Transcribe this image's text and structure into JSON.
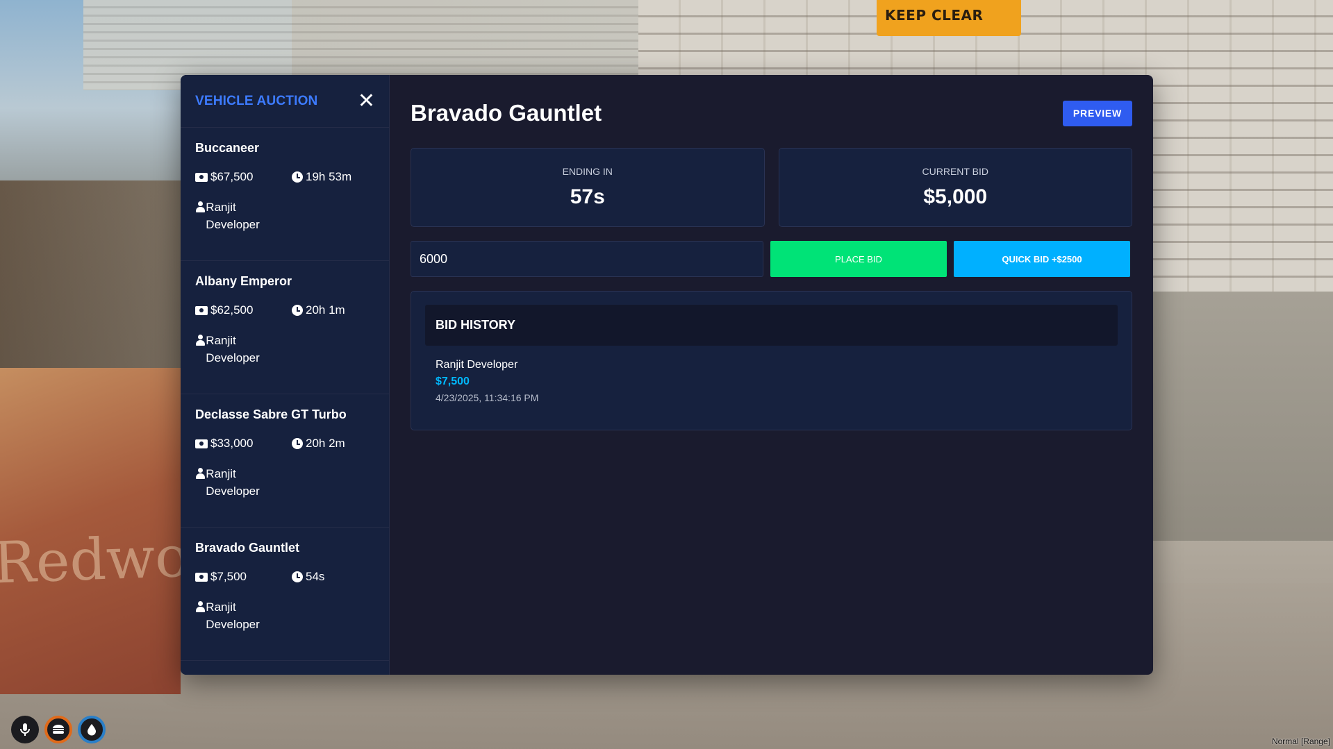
{
  "background": {
    "sign_text": "KEEP CLEAR",
    "box_text": "Redwood"
  },
  "sidebar": {
    "title": "VEHICLE AUCTION",
    "close_glyph": "✕",
    "items": [
      {
        "name": "Buccaneer",
        "price": "$67,500",
        "time": "19h 53m",
        "owner": "Ranjit Developer"
      },
      {
        "name": "Albany Emperor",
        "price": "$62,500",
        "time": "20h 1m",
        "owner": "Ranjit Developer"
      },
      {
        "name": "Declasse Sabre GT Turbo",
        "price": "$33,000",
        "time": "20h 2m",
        "owner": "Ranjit Developer"
      },
      {
        "name": "Bravado Gauntlet",
        "price": "$7,500",
        "time": "54s",
        "owner": "Ranjit Developer"
      }
    ]
  },
  "main": {
    "title": "Bravado Gauntlet",
    "preview_label": "PREVIEW",
    "ending_label": "ENDING IN",
    "ending_value": "57s",
    "current_label": "CURRENT BID",
    "current_value": "$5,000",
    "bid_input_value": "6000",
    "place_bid_label": "PLACE BID",
    "quick_bid_label": "QUICK BID +$2500",
    "history": {
      "title": "BID HISTORY",
      "entries": [
        {
          "name": "Ranjit Developer",
          "amount": "$7,500",
          "date": "4/23/2025, 11:34:16 PM"
        }
      ]
    }
  },
  "hud": {
    "mic_icon": "microphone-icon",
    "food_icon": "burger-icon",
    "water_icon": "water-drop-icon",
    "voice_mode": "Normal [Range]"
  },
  "colors": {
    "accent_blue": "#3d7bff",
    "place_bid_green": "#00e377",
    "quick_bid_cyan": "#00b0ff",
    "panel_bg": "#1a1b2e",
    "card_bg": "#16213e"
  }
}
